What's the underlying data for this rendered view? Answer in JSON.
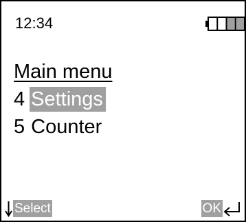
{
  "status_bar": {
    "time": "12:34",
    "battery_icon": "battery-icon",
    "battery_level": 0.6
  },
  "menu": {
    "title": "Main menu",
    "items": [
      {
        "number": "4",
        "label": "Settings",
        "selected": true
      },
      {
        "number": "5",
        "label": "Counter",
        "selected": false
      }
    ]
  },
  "softkeys": {
    "left": {
      "icon": "down-arrow-icon",
      "label": "Select"
    },
    "right": {
      "icon": "enter-icon",
      "label": "OK"
    }
  },
  "colors": {
    "highlight": "#a0a0a0",
    "highlight_text": "#ffffff",
    "foreground": "#000000",
    "background": "#ffffff"
  }
}
